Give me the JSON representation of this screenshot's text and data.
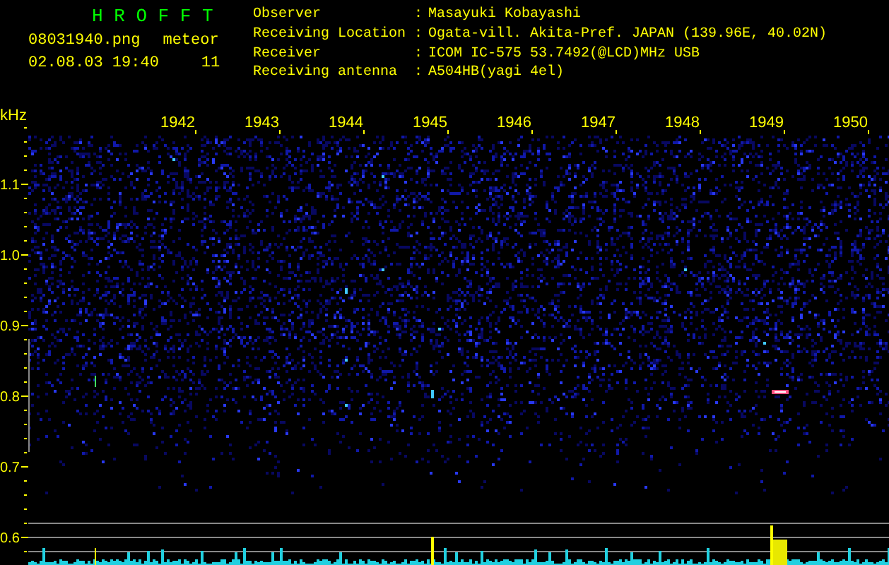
{
  "header": {
    "program_title": "H R O F F T",
    "file_name": "08031940.png",
    "date_time": "02.08.03 19:40",
    "meteor_label": "meteor",
    "meteor_count": "11"
  },
  "station_info": [
    {
      "label": "Observer",
      "separator": ":",
      "value": "Masayuki Kobayashi"
    },
    {
      "label": "Receiving Location",
      "separator": ":",
      "value": "Ogata-vill. Akita-Pref. JAPAN (139.96E, 40.02N)"
    },
    {
      "label": "Receiver",
      "separator": ":",
      "value": "ICOM IC-575 53.7492(@LCD)MHz USB"
    },
    {
      "label": "Receiving antenna",
      "separator": ":",
      "value": "A504HB(yagi 4el)"
    }
  ],
  "spectrogram": {
    "frequency_unit": "kHz",
    "frequency_labels": [
      "1.1",
      "1.0",
      "0.9",
      "0.8",
      "0.7",
      "0.6"
    ],
    "time_labels": [
      "1942",
      "1943",
      "1944",
      "1945",
      "1946",
      "1947",
      "1948",
      "1949",
      "1950"
    ]
  }
}
